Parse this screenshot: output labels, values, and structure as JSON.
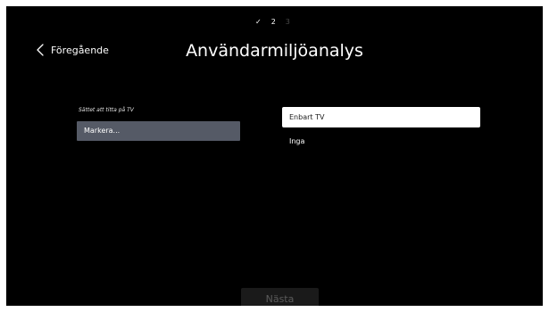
{
  "steps": {
    "done": "✓",
    "current": "2",
    "next": "3"
  },
  "nav": {
    "back_label": "Föregående"
  },
  "page": {
    "title": "Användarmiljöanalys"
  },
  "form": {
    "field_label": "Sättet att titta på TV",
    "select_value": "Markera..."
  },
  "options": [
    {
      "label": "Enbart TV",
      "selected": true
    },
    {
      "label": "Inga",
      "selected": false
    }
  ],
  "footer": {
    "next_label": "Nästa"
  },
  "colors": {
    "background": "#000000",
    "select_bg": "#555a66",
    "option_selected_bg": "#ffffff",
    "button_disabled_bg": "#1a1a1a",
    "button_disabled_text": "#5b5b5b"
  },
  "icons": {
    "back": "chevron-left-icon"
  }
}
